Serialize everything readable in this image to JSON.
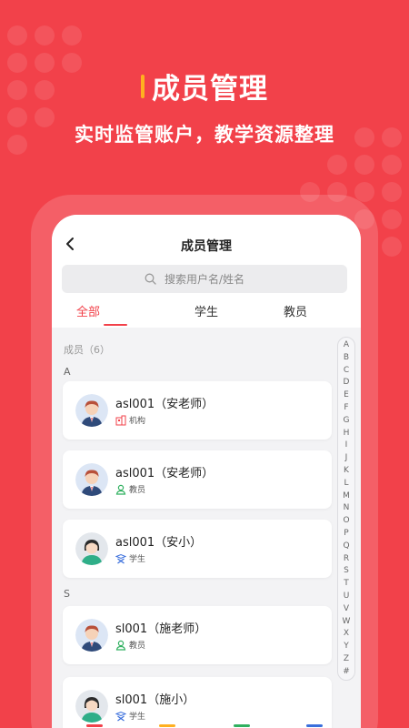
{
  "hero": {
    "title": "成员管理",
    "subtitle": "实时监管账户，教学资源整理"
  },
  "colors": {
    "accent": "#f2414a",
    "hero_bar": "#ffb020",
    "org_icon": "#f2414a",
    "teacher_icon": "#2fb05f",
    "student_icon": "#3a6fdc"
  },
  "app": {
    "nav_title": "成员管理",
    "search_placeholder": "搜索用户名/姓名",
    "tabs": [
      {
        "label": "全部",
        "active": true
      },
      {
        "label": "学生",
        "active": false
      },
      {
        "label": "教员",
        "active": false
      }
    ],
    "member_count": "成员（6）",
    "sections": [
      {
        "letter": "A",
        "members": [
          {
            "name": "asl001（安老师）",
            "role": "机构",
            "role_icon": "building-icon",
            "avatar": "male-avatar"
          },
          {
            "name": "asl001（安老师）",
            "role": "教员",
            "role_icon": "person-icon",
            "avatar": "male-avatar"
          },
          {
            "name": "asl001（安小）",
            "role": "学生",
            "role_icon": "student-icon",
            "avatar": "female-avatar"
          }
        ]
      },
      {
        "letter": "S",
        "members": [
          {
            "name": "sl001（施老师）",
            "role": "教员",
            "role_icon": "person-icon",
            "avatar": "male-avatar"
          },
          {
            "name": "sl001（施小）",
            "role": "学生",
            "role_icon": "student-icon",
            "avatar": "female-avatar"
          }
        ]
      }
    ],
    "az_index": [
      "A",
      "B",
      "C",
      "D",
      "E",
      "F",
      "G",
      "H",
      "I",
      "J",
      "K",
      "L",
      "M",
      "N",
      "O",
      "P",
      "Q",
      "R",
      "S",
      "T",
      "U",
      "V",
      "W",
      "X",
      "Y",
      "Z",
      "#"
    ]
  }
}
